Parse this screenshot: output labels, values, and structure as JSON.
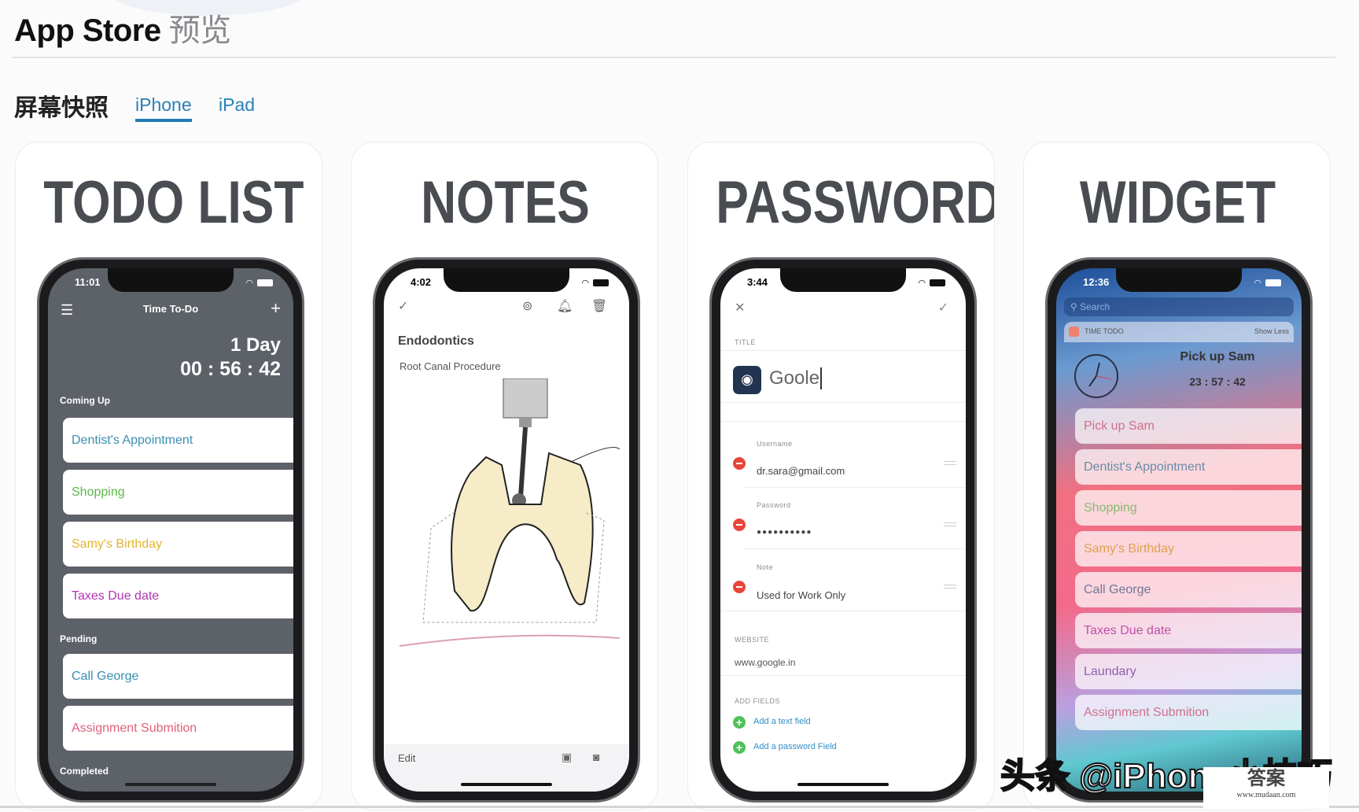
{
  "header": {
    "title": "App Store",
    "title_suffix": "预览"
  },
  "screenshots": {
    "title": "屏幕快照",
    "tabs": [
      {
        "label": "iPhone",
        "active": true
      },
      {
        "label": "iPad",
        "active": false
      }
    ]
  },
  "cards": [
    {
      "title": "TODO LIST",
      "status_time": "11:01",
      "nav_title": "Time To-Do",
      "countdown_day": "1 Day",
      "countdown_time": "00 : 56 : 42",
      "sections": [
        {
          "label": "Coming Up"
        },
        {
          "label": "Pending"
        },
        {
          "label": "Completed"
        }
      ],
      "items": [
        {
          "label": "Dentist's Appointment",
          "color": "#3a8fb0"
        },
        {
          "label": "Shopping",
          "color": "#5cb84a"
        },
        {
          "label": "Samy's Birthday",
          "color": "#e2b530"
        },
        {
          "label": "Taxes Due date",
          "color": "#b034b0"
        },
        {
          "label": "Call George",
          "color": "#3a8fb0"
        },
        {
          "label": "Assignment Submition",
          "color": "#e0607e"
        }
      ]
    },
    {
      "title": "NOTES",
      "status_time": "4:02",
      "note_title": "Endodontics",
      "note_subtitle": "Root Canal Procedure",
      "edit_label": "Edit"
    },
    {
      "title": "PASSWORDS",
      "status_time": "3:44",
      "title_label": "TITLE",
      "title_value": "Goole",
      "fields": [
        {
          "label": "Username",
          "value": "dr.sara@gmail.com"
        },
        {
          "label": "Password",
          "value": "●●●●●●●●●●"
        },
        {
          "label": "Note",
          "value": "Used for Work Only"
        }
      ],
      "website_label": "WEBSITE",
      "website_value": "www.google.in",
      "add_fields_label": "ADD FIELDS",
      "add_text_field": "Add a text field",
      "add_password_field": "Add a password Field"
    },
    {
      "title": "WIDGET",
      "status_time": "12:36",
      "search_placeholder": "Search",
      "widget_app": "TIME TODO",
      "show_less": "Show Less",
      "event_title": "Pick up Sam",
      "event_time": "23 : 57 : 42",
      "items": [
        {
          "label": "Pick up Sam",
          "color": "#d0708a"
        },
        {
          "label": "Dentist's Appointment",
          "color": "#6a8aa8"
        },
        {
          "label": "Shopping",
          "color": "#8ab870"
        },
        {
          "label": "Samy's Birthday",
          "color": "#e0a050"
        },
        {
          "label": "Call George",
          "color": "#707898"
        },
        {
          "label": "Taxes Due date",
          "color": "#c050a8"
        },
        {
          "label": "Laundary",
          "color": "#9060b0"
        },
        {
          "label": "Assignment Submition",
          "color": "#d07090"
        }
      ]
    }
  ],
  "watermark": {
    "text": "头条 @iPhone小技巧",
    "logo_text": "答案",
    "logo_url": "www.mudaan.com"
  },
  "colors": {
    "accent": "#1f7ab3",
    "todo_bg": "#5d6168"
  }
}
